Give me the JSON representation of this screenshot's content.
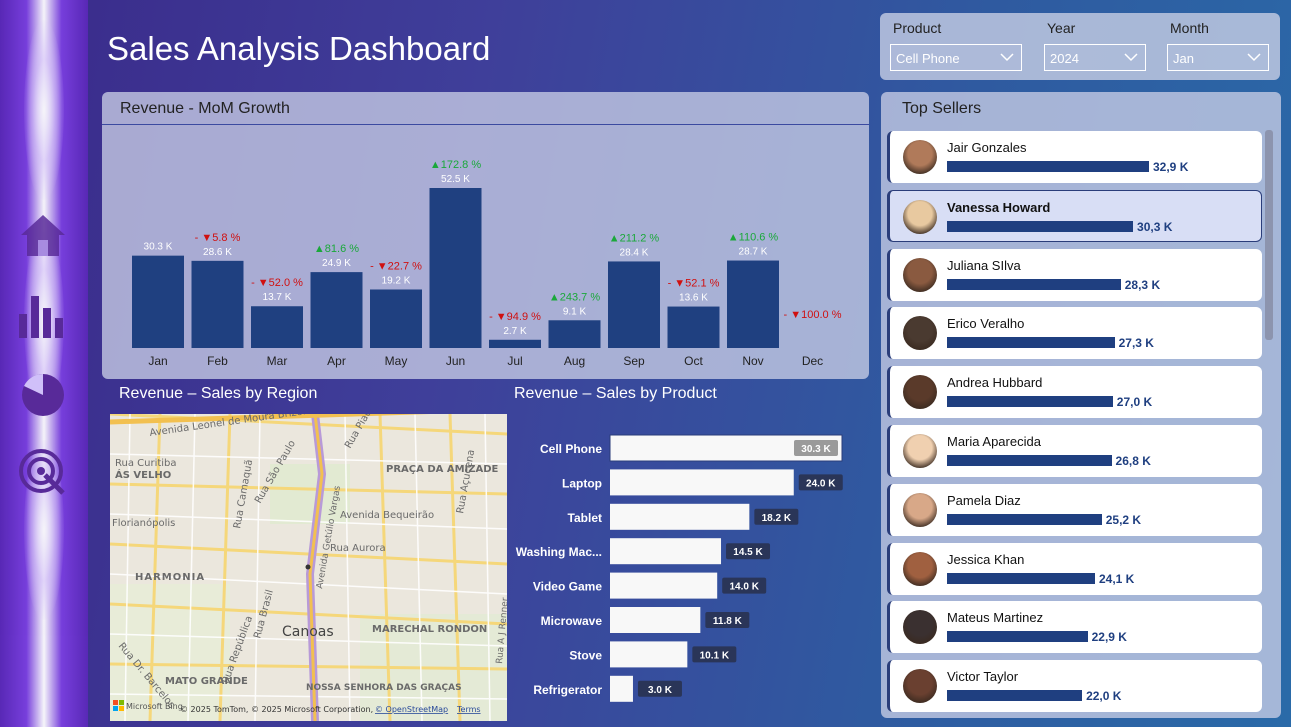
{
  "title": "Sales Analysis Dashboard",
  "nav": [
    {
      "name": "home-icon"
    },
    {
      "name": "bar-chart-icon"
    },
    {
      "name": "pie-chart-icon"
    },
    {
      "name": "target-icon"
    }
  ],
  "filters": {
    "product": {
      "label": "Product",
      "value": "Cell Phone"
    },
    "year": {
      "label": "Year",
      "value": "2024"
    },
    "month": {
      "label": "Month",
      "value": "Jan"
    }
  },
  "mom": {
    "title": "Revenue - MoM Growth"
  },
  "region": {
    "title": "Revenue – Sales by Region",
    "labels": [
      "Avenida Leonel de Moura Brizola",
      "Rua Curitiba",
      "ÁS VELHO",
      "Florianópolis",
      "HARMONIA",
      "Rua Camaquã",
      "Rua São Paulo",
      "Avenida Getúlio Vargas",
      "Rua Piauí",
      "PRAÇA DA AMIZADE",
      "Rua Açucena",
      "Avenida Bequeirão",
      "Rua Aurora",
      "Canoas",
      "MARECHAL RONDON",
      "Rua Brasil",
      "Rua República",
      "Rua Dr. Barcelos",
      "MATO GRANDE",
      "NOSSA SENHORA DAS GRAÇAS",
      "Rua A J Renner"
    ],
    "attribution": "© 2025 TomTom, © 2025 Microsoft Corporation,",
    "osm": "© OpenStreetMap",
    "terms": "Terms",
    "brand": "Microsoft Bing"
  },
  "product_title": "Revenue – Sales by Product",
  "sellers_title": "Top Sellers",
  "sellers": [
    {
      "name": "Jair Gonzales",
      "value": "32,9 K",
      "amount": 32.9,
      "selected": false,
      "skin": "#b07a5a"
    },
    {
      "name": "Vanessa Howard",
      "value": "30,3 K",
      "amount": 30.3,
      "selected": true,
      "skin": "#e8c9a0"
    },
    {
      "name": "Juliana SIlva",
      "value": "28,3 K",
      "amount": 28.3,
      "selected": false,
      "skin": "#8a5a40"
    },
    {
      "name": "Erico Veralho",
      "value": "27,3 K",
      "amount": 27.3,
      "selected": false,
      "skin": "#4a3a30"
    },
    {
      "name": "Andrea Hubbard",
      "value": "27,0 K",
      "amount": 27.0,
      "selected": false,
      "skin": "#5a3a2a"
    },
    {
      "name": "Maria Aparecida",
      "value": "26,8 K",
      "amount": 26.8,
      "selected": false,
      "skin": "#f0d0b0"
    },
    {
      "name": "Pamela Diaz",
      "value": "25,2 K",
      "amount": 25.2,
      "selected": false,
      "skin": "#d8a888"
    },
    {
      "name": "Jessica Khan",
      "value": "24,1 K",
      "amount": 24.1,
      "selected": false,
      "skin": "#a06040"
    },
    {
      "name": "Mateus Martinez",
      "value": "22,9 K",
      "amount": 22.9,
      "selected": false,
      "skin": "#3a3030"
    },
    {
      "name": "Victor Taylor",
      "value": "22,0 K",
      "amount": 22.0,
      "selected": false,
      "skin": "#6a4030"
    }
  ],
  "colors": {
    "bar": "#1f4080",
    "up": "#1aa83a",
    "down": "#d01010",
    "label": "#ffffff"
  },
  "chart_data": [
    {
      "type": "bar",
      "title": "Revenue - MoM Growth",
      "categories": [
        "Jan",
        "Feb",
        "Mar",
        "Apr",
        "May",
        "Jun",
        "Jul",
        "Aug",
        "Sep",
        "Oct",
        "Nov",
        "Dec"
      ],
      "values": [
        30.3,
        28.6,
        13.7,
        24.9,
        19.2,
        52.5,
        2.7,
        9.1,
        28.4,
        13.6,
        28.7,
        0
      ],
      "value_labels": [
        "30.3 K",
        "28.6 K",
        "13.7 K",
        "24.9 K",
        "19.2 K",
        "52.5 K",
        "2.7 K",
        "9.1 K",
        "28.4 K",
        "13.6 K",
        "28.7 K",
        ""
      ],
      "growth_labels": [
        "",
        "- ▼5.8 %",
        "- ▼52.0 %",
        "▲81.6 %",
        "- ▼22.7 %",
        "▲172.8 %",
        "- ▼94.9 %",
        "▲243.7 %",
        "▲211.2 %",
        "- ▼52.1 %",
        "▲110.6 %",
        "- ▼100.0 %"
      ],
      "growth_dir": [
        "",
        "down",
        "down",
        "up",
        "down",
        "up",
        "down",
        "up",
        "up",
        "down",
        "up",
        "down"
      ],
      "ylim": [
        0,
        60
      ]
    },
    {
      "type": "bar",
      "title": "Revenue – Sales by Product",
      "categories": [
        "Cell Phone",
        "Laptop",
        "Tablet",
        "Washing Mac...",
        "Video Game",
        "Microwave",
        "Stove",
        "Refrigerator"
      ],
      "values": [
        30.3,
        24.0,
        18.2,
        14.5,
        14.0,
        11.8,
        10.1,
        3.0
      ],
      "value_labels": [
        "30.3 K",
        "24.0 K",
        "18.2 K",
        "14.5 K",
        "14.0 K",
        "11.8 K",
        "10.1 K",
        "3.0 K"
      ],
      "selected": "Cell Phone"
    }
  ]
}
